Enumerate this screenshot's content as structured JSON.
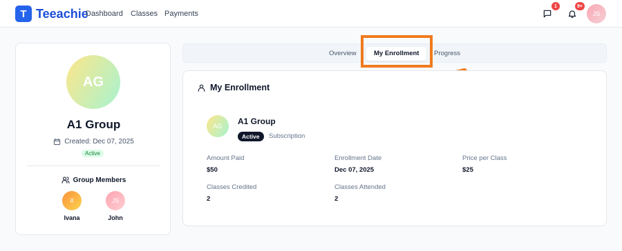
{
  "app": {
    "logo_letter": "T",
    "name": "Teeachie",
    "nav": [
      "Dashboard",
      "Classes",
      "Payments"
    ],
    "messages_badge": "1",
    "notifications_badge": "9+",
    "user_initials": "JS"
  },
  "group": {
    "initials": "AG",
    "name": "A1 Group",
    "created": "Created: Dec 07, 2025",
    "status": "Active",
    "members_title": "Group Members",
    "members": [
      {
        "initials": "II",
        "name": "Ivana"
      },
      {
        "initials": "JS",
        "name": "John"
      }
    ]
  },
  "tabs": [
    "Overview",
    "My Enrollment",
    "Progress"
  ],
  "enrollment": {
    "section_title": "My Enrollment",
    "group_initials": "AG",
    "group_name": "A1 Group",
    "status": "Active",
    "type": "Subscription",
    "fields": [
      {
        "label": "Amount Paid",
        "value": "$50"
      },
      {
        "label": "Enrollment Date",
        "value": "Dec 07, 2025"
      },
      {
        "label": "Price per Class",
        "value": "$25"
      },
      {
        "label": "Classes Credited",
        "value": "2"
      },
      {
        "label": "Classes Attended",
        "value": "2"
      }
    ]
  },
  "colors": {
    "brand": "#2563eb",
    "highlight": "#f07b1d",
    "badge": "#ef4444",
    "active_pill": "#dcfce7"
  }
}
